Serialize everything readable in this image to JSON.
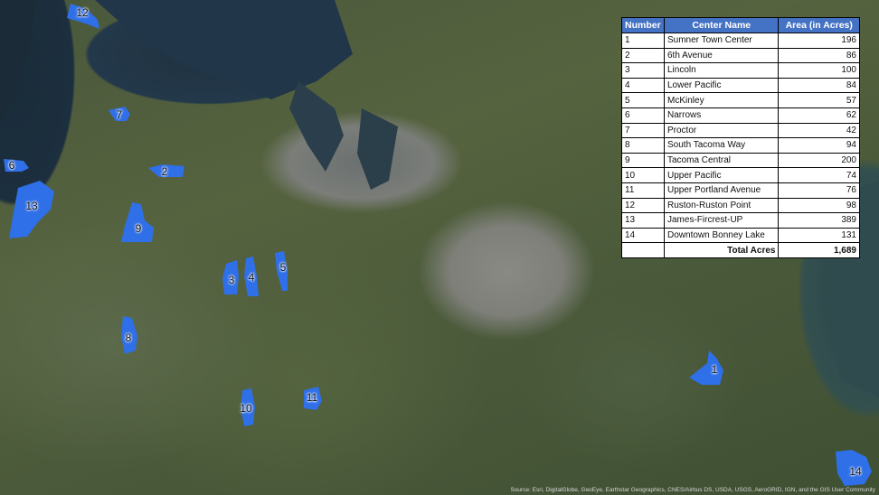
{
  "map": {
    "colors": {
      "center_fill": "#2f6fe8",
      "table_header": "#4472c4"
    },
    "centers": [
      {
        "number": "1",
        "name": "Sumner Town Center",
        "area": "196"
      },
      {
        "number": "2",
        "name": "6th Avenue",
        "area": "86"
      },
      {
        "number": "3",
        "name": "Lincoln",
        "area": "100"
      },
      {
        "number": "4",
        "name": "Lower Pacific",
        "area": "84"
      },
      {
        "number": "5",
        "name": "McKinley",
        "area": "57"
      },
      {
        "number": "6",
        "name": "Narrows",
        "area": "62"
      },
      {
        "number": "7",
        "name": "Proctor",
        "area": "42"
      },
      {
        "number": "8",
        "name": "South Tacoma Way",
        "area": "94"
      },
      {
        "number": "9",
        "name": "Tacoma Central",
        "area": "200"
      },
      {
        "number": "10",
        "name": "Upper Pacific",
        "area": "74"
      },
      {
        "number": "11",
        "name": "Upper Portland Avenue",
        "area": "76"
      },
      {
        "number": "12",
        "name": "Ruston-Ruston Point",
        "area": "98"
      },
      {
        "number": "13",
        "name": "James-Fircrest-UP",
        "area": "389"
      },
      {
        "number": "14",
        "name": "Downtown Bonney Lake",
        "area": "131"
      }
    ]
  },
  "table": {
    "headers": {
      "number": "Number",
      "name": "Center Name",
      "area": "Area (in Acres)"
    },
    "total_label": "Total Acres",
    "total_value": "1,689"
  },
  "attribution": "Source: Esri, DigitalGlobe, GeoEye, Earthstar Geographics, CNES/Airbus DS, USDA, USGS, AeroGRID, IGN, and the GIS User Community"
}
